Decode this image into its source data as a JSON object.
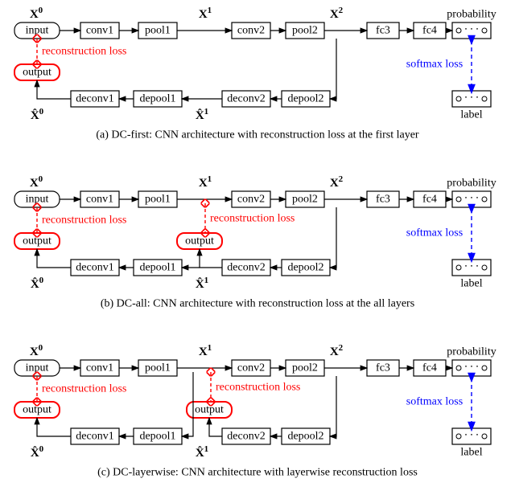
{
  "colors": {
    "red": "#f00",
    "blue": "#00f"
  },
  "common": {
    "input": "input",
    "output": "output",
    "conv1": "conv1",
    "pool1": "pool1",
    "conv2": "conv2",
    "pool2": "pool2",
    "fc3": "fc3",
    "fc4": "fc4",
    "deconv1": "deconv1",
    "depool1": "depool1",
    "deconv2": "deconv2",
    "depool2": "depool2",
    "probability": "probability",
    "label": "label",
    "softmax_loss": "softmax loss",
    "reconstruction_loss": "reconstruction loss",
    "X0": "X",
    "sup0": "0",
    "X1": "X",
    "sup1": "1",
    "X2": "X",
    "sup2": "2",
    "Xh0": "X̂",
    "sh0": "0",
    "Xh1": "X̂",
    "sh1": "1",
    "dots": "∙ ∙ ∙"
  },
  "a": {
    "caption": "(a) DC-first: CNN architecture with reconstruction loss at the first layer"
  },
  "b": {
    "caption": "(b) DC-all: CNN architecture with reconstruction loss at the all layers"
  },
  "c": {
    "caption": "(c) DC-layerwise: CNN architecture with layerwise reconstruction loss"
  }
}
